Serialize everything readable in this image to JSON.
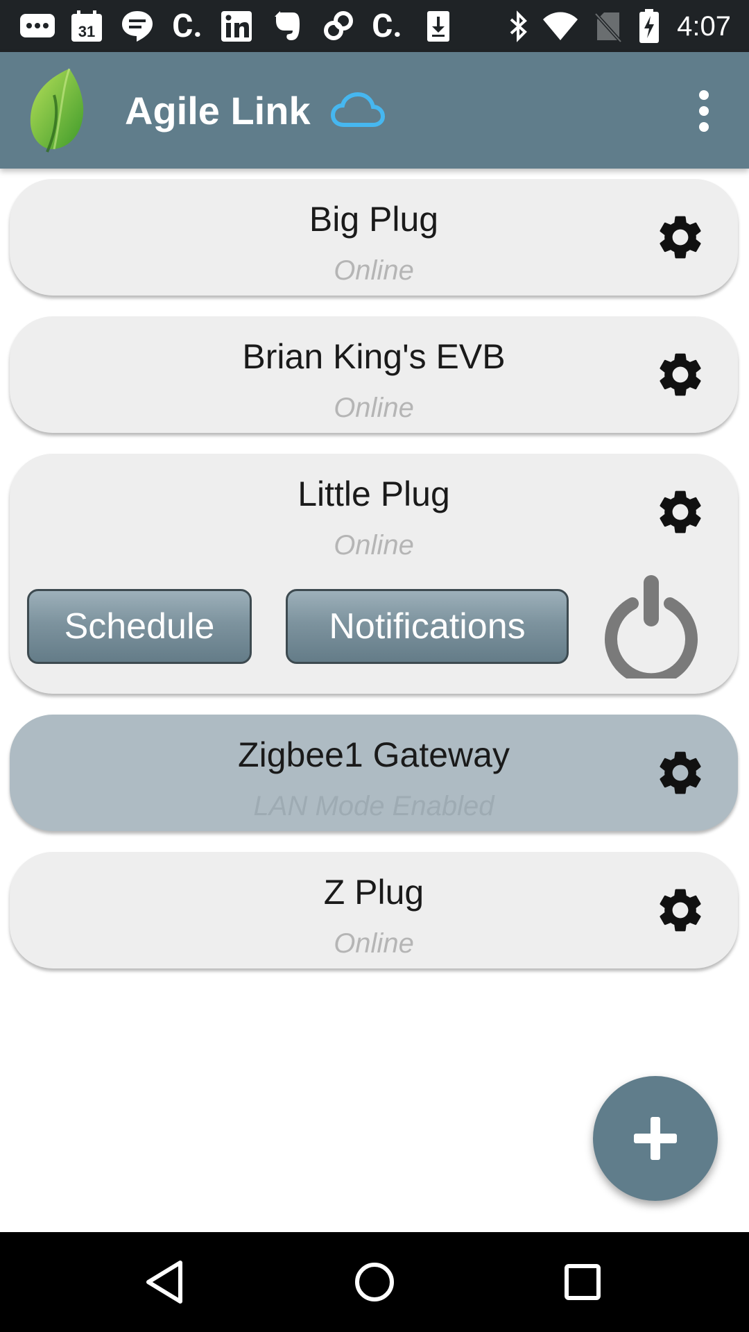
{
  "status_bar": {
    "time": "4:07",
    "icons": [
      "messaging-icon",
      "calendar-icon",
      "hangouts-icon",
      "c-app-icon",
      "linkedin-icon",
      "evernote-icon",
      "link-app-icon",
      "c-app-icon",
      "download-icon",
      "bluetooth-icon",
      "wifi-icon",
      "no-sim-icon",
      "battery-charging-icon"
    ],
    "calendar_day": "31"
  },
  "app_bar": {
    "title": "Agile Link",
    "logo": "leaf-logo",
    "cloud": "cloud-icon",
    "menu": "more-vert-icon",
    "accent": "#607d8b"
  },
  "devices": [
    {
      "name": "Big Plug",
      "status": "Online",
      "expanded": false,
      "selected": false
    },
    {
      "name": "Brian King's EVB",
      "status": "Online",
      "expanded": false,
      "selected": false
    },
    {
      "name": "Little Plug",
      "status": "Online",
      "expanded": true,
      "selected": false,
      "actions": {
        "schedule": "Schedule",
        "notifications": "Notifications"
      }
    },
    {
      "name": "Zigbee1 Gateway",
      "status": "LAN Mode Enabled",
      "expanded": false,
      "selected": true
    },
    {
      "name": "Z Plug",
      "status": "Online",
      "expanded": false,
      "selected": false
    }
  ],
  "fab": {
    "icon": "add-icon"
  },
  "nav_bar": {
    "buttons": [
      "back-icon",
      "home-icon",
      "recents-icon"
    ]
  }
}
